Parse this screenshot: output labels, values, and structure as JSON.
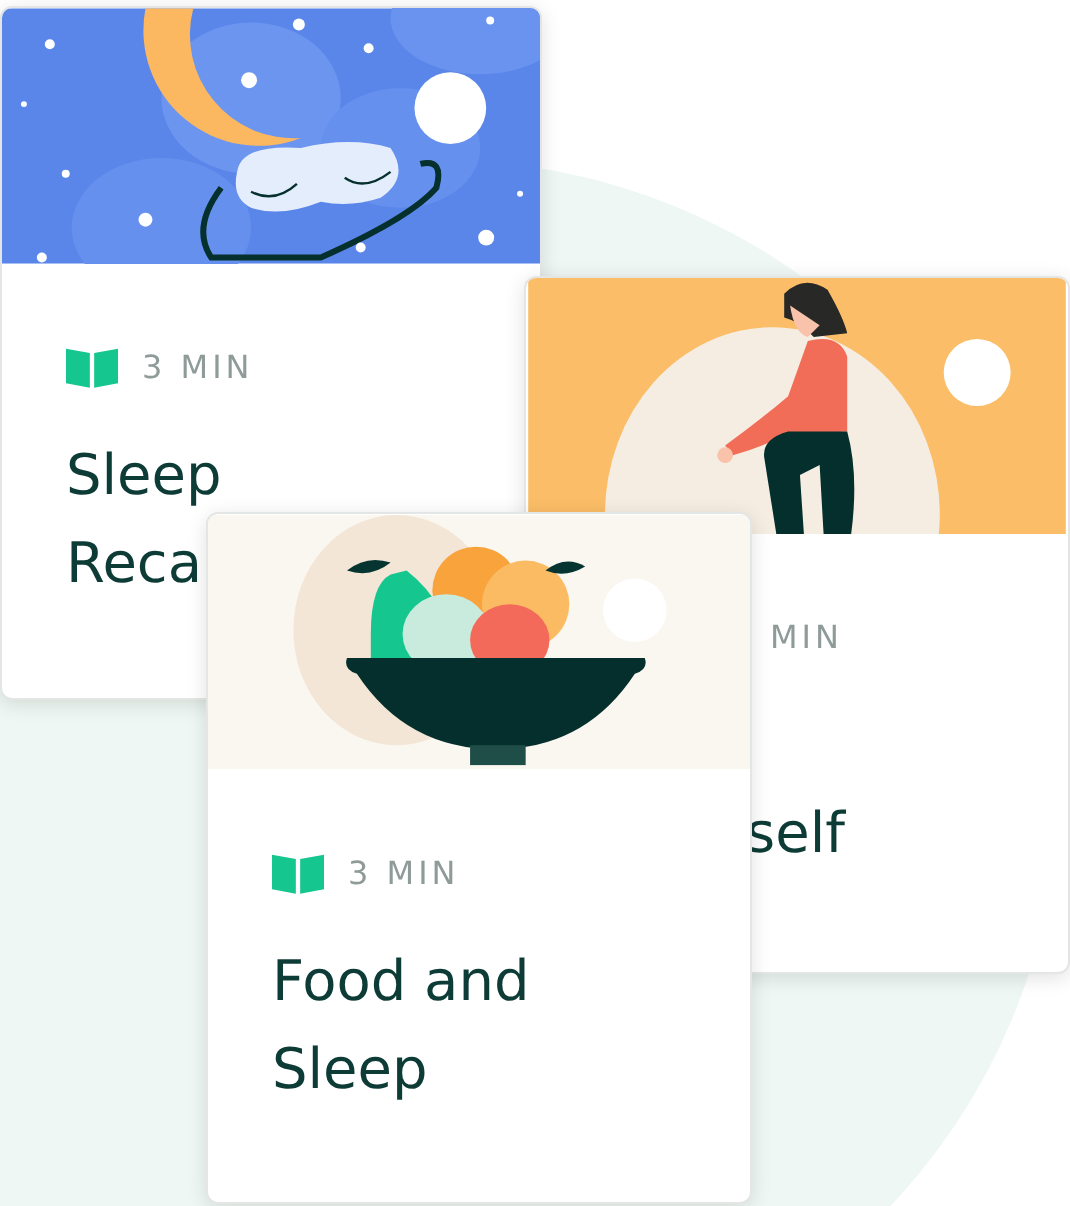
{
  "cards": [
    {
      "kind": "night-sky",
      "book_icon": true,
      "duration": "3 MIN",
      "title": "Sleep Reca"
    },
    {
      "kind": "exercise",
      "book_icon": false,
      "duration": "MIN",
      "title": "self"
    },
    {
      "kind": "fruit-bowl",
      "book_icon": true,
      "duration": "3 MIN",
      "title": "Food and Sleep"
    }
  ]
}
